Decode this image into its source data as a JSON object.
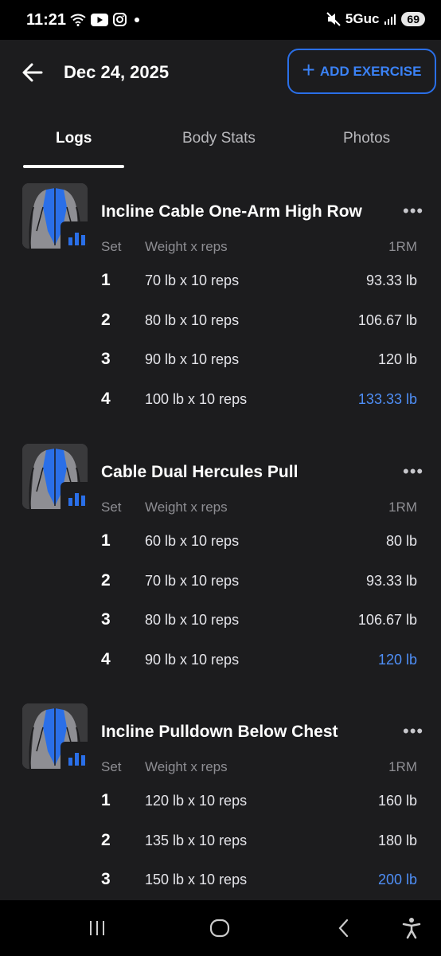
{
  "status": {
    "time": "11:21",
    "network": "5Guc",
    "battery": "69"
  },
  "header": {
    "title": "Dec 24, 2025",
    "add_label": "ADD EXERCISE"
  },
  "tabs": [
    {
      "label": "Logs",
      "active": true
    },
    {
      "label": "Body Stats",
      "active": false
    },
    {
      "label": "Photos",
      "active": false
    }
  ],
  "columns": {
    "set": "Set",
    "weight_reps": "Weight x reps",
    "one_rm": "1RM"
  },
  "exercises": [
    {
      "name": "Incline Cable One-Arm High Row",
      "sets": [
        {
          "set": "1",
          "weight_reps": "70 lb x 10 reps",
          "one_rm": "93.33 lb"
        },
        {
          "set": "2",
          "weight_reps": "80 lb x 10 reps",
          "one_rm": "106.67 lb"
        },
        {
          "set": "3",
          "weight_reps": "90 lb x 10 reps",
          "one_rm": "120 lb"
        },
        {
          "set": "4",
          "weight_reps": "100 lb x 10 reps",
          "one_rm": "133.33 lb",
          "best": true
        }
      ]
    },
    {
      "name": "Cable Dual Hercules Pull",
      "sets": [
        {
          "set": "1",
          "weight_reps": "60 lb x 10 reps",
          "one_rm": "80 lb"
        },
        {
          "set": "2",
          "weight_reps": "70 lb x 10 reps",
          "one_rm": "93.33 lb"
        },
        {
          "set": "3",
          "weight_reps": "80 lb x 10 reps",
          "one_rm": "106.67 lb"
        },
        {
          "set": "4",
          "weight_reps": "90 lb x 10 reps",
          "one_rm": "120 lb",
          "best": true
        }
      ]
    },
    {
      "name": "Incline Pulldown Below Chest",
      "sets": [
        {
          "set": "1",
          "weight_reps": "120 lb x 10 reps",
          "one_rm": "160 lb"
        },
        {
          "set": "2",
          "weight_reps": "135 lb x 10 reps",
          "one_rm": "180 lb"
        },
        {
          "set": "3",
          "weight_reps": "150 lb x 10 reps",
          "one_rm": "200 lb",
          "best": true
        }
      ]
    }
  ],
  "icons": {
    "back": "arrow-left-icon",
    "add": "plus-icon",
    "more": "more-horizontal-icon",
    "stats": "bar-chart-icon",
    "muscle": "back-muscles-icon"
  },
  "colors": {
    "accent": "#2a6fe8",
    "best_value": "#4f8ff7",
    "background": "#1c1c1e"
  }
}
